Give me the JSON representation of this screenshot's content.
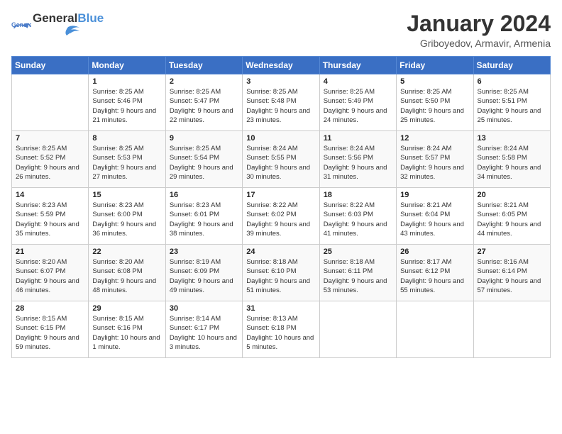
{
  "logo": {
    "text_general": "General",
    "text_blue": "Blue"
  },
  "title": "January 2024",
  "subtitle": "Griboyedov, Armavir, Armenia",
  "weekdays": [
    "Sunday",
    "Monday",
    "Tuesday",
    "Wednesday",
    "Thursday",
    "Friday",
    "Saturday"
  ],
  "weeks": [
    [
      {
        "day": "",
        "sunrise": "",
        "sunset": "",
        "daylight": ""
      },
      {
        "day": "1",
        "sunrise": "Sunrise: 8:25 AM",
        "sunset": "Sunset: 5:46 PM",
        "daylight": "Daylight: 9 hours and 21 minutes."
      },
      {
        "day": "2",
        "sunrise": "Sunrise: 8:25 AM",
        "sunset": "Sunset: 5:47 PM",
        "daylight": "Daylight: 9 hours and 22 minutes."
      },
      {
        "day": "3",
        "sunrise": "Sunrise: 8:25 AM",
        "sunset": "Sunset: 5:48 PM",
        "daylight": "Daylight: 9 hours and 23 minutes."
      },
      {
        "day": "4",
        "sunrise": "Sunrise: 8:25 AM",
        "sunset": "Sunset: 5:49 PM",
        "daylight": "Daylight: 9 hours and 24 minutes."
      },
      {
        "day": "5",
        "sunrise": "Sunrise: 8:25 AM",
        "sunset": "Sunset: 5:50 PM",
        "daylight": "Daylight: 9 hours and 25 minutes."
      },
      {
        "day": "6",
        "sunrise": "Sunrise: 8:25 AM",
        "sunset": "Sunset: 5:51 PM",
        "daylight": "Daylight: 9 hours and 25 minutes."
      }
    ],
    [
      {
        "day": "7",
        "sunrise": "Sunrise: 8:25 AM",
        "sunset": "Sunset: 5:52 PM",
        "daylight": "Daylight: 9 hours and 26 minutes."
      },
      {
        "day": "8",
        "sunrise": "Sunrise: 8:25 AM",
        "sunset": "Sunset: 5:53 PM",
        "daylight": "Daylight: 9 hours and 27 minutes."
      },
      {
        "day": "9",
        "sunrise": "Sunrise: 8:25 AM",
        "sunset": "Sunset: 5:54 PM",
        "daylight": "Daylight: 9 hours and 29 minutes."
      },
      {
        "day": "10",
        "sunrise": "Sunrise: 8:24 AM",
        "sunset": "Sunset: 5:55 PM",
        "daylight": "Daylight: 9 hours and 30 minutes."
      },
      {
        "day": "11",
        "sunrise": "Sunrise: 8:24 AM",
        "sunset": "Sunset: 5:56 PM",
        "daylight": "Daylight: 9 hours and 31 minutes."
      },
      {
        "day": "12",
        "sunrise": "Sunrise: 8:24 AM",
        "sunset": "Sunset: 5:57 PM",
        "daylight": "Daylight: 9 hours and 32 minutes."
      },
      {
        "day": "13",
        "sunrise": "Sunrise: 8:24 AM",
        "sunset": "Sunset: 5:58 PM",
        "daylight": "Daylight: 9 hours and 34 minutes."
      }
    ],
    [
      {
        "day": "14",
        "sunrise": "Sunrise: 8:23 AM",
        "sunset": "Sunset: 5:59 PM",
        "daylight": "Daylight: 9 hours and 35 minutes."
      },
      {
        "day": "15",
        "sunrise": "Sunrise: 8:23 AM",
        "sunset": "Sunset: 6:00 PM",
        "daylight": "Daylight: 9 hours and 36 minutes."
      },
      {
        "day": "16",
        "sunrise": "Sunrise: 8:23 AM",
        "sunset": "Sunset: 6:01 PM",
        "daylight": "Daylight: 9 hours and 38 minutes."
      },
      {
        "day": "17",
        "sunrise": "Sunrise: 8:22 AM",
        "sunset": "Sunset: 6:02 PM",
        "daylight": "Daylight: 9 hours and 39 minutes."
      },
      {
        "day": "18",
        "sunrise": "Sunrise: 8:22 AM",
        "sunset": "Sunset: 6:03 PM",
        "daylight": "Daylight: 9 hours and 41 minutes."
      },
      {
        "day": "19",
        "sunrise": "Sunrise: 8:21 AM",
        "sunset": "Sunset: 6:04 PM",
        "daylight": "Daylight: 9 hours and 43 minutes."
      },
      {
        "day": "20",
        "sunrise": "Sunrise: 8:21 AM",
        "sunset": "Sunset: 6:05 PM",
        "daylight": "Daylight: 9 hours and 44 minutes."
      }
    ],
    [
      {
        "day": "21",
        "sunrise": "Sunrise: 8:20 AM",
        "sunset": "Sunset: 6:07 PM",
        "daylight": "Daylight: 9 hours and 46 minutes."
      },
      {
        "day": "22",
        "sunrise": "Sunrise: 8:20 AM",
        "sunset": "Sunset: 6:08 PM",
        "daylight": "Daylight: 9 hours and 48 minutes."
      },
      {
        "day": "23",
        "sunrise": "Sunrise: 8:19 AM",
        "sunset": "Sunset: 6:09 PM",
        "daylight": "Daylight: 9 hours and 49 minutes."
      },
      {
        "day": "24",
        "sunrise": "Sunrise: 8:18 AM",
        "sunset": "Sunset: 6:10 PM",
        "daylight": "Daylight: 9 hours and 51 minutes."
      },
      {
        "day": "25",
        "sunrise": "Sunrise: 8:18 AM",
        "sunset": "Sunset: 6:11 PM",
        "daylight": "Daylight: 9 hours and 53 minutes."
      },
      {
        "day": "26",
        "sunrise": "Sunrise: 8:17 AM",
        "sunset": "Sunset: 6:12 PM",
        "daylight": "Daylight: 9 hours and 55 minutes."
      },
      {
        "day": "27",
        "sunrise": "Sunrise: 8:16 AM",
        "sunset": "Sunset: 6:14 PM",
        "daylight": "Daylight: 9 hours and 57 minutes."
      }
    ],
    [
      {
        "day": "28",
        "sunrise": "Sunrise: 8:15 AM",
        "sunset": "Sunset: 6:15 PM",
        "daylight": "Daylight: 9 hours and 59 minutes."
      },
      {
        "day": "29",
        "sunrise": "Sunrise: 8:15 AM",
        "sunset": "Sunset: 6:16 PM",
        "daylight": "Daylight: 10 hours and 1 minute."
      },
      {
        "day": "30",
        "sunrise": "Sunrise: 8:14 AM",
        "sunset": "Sunset: 6:17 PM",
        "daylight": "Daylight: 10 hours and 3 minutes."
      },
      {
        "day": "31",
        "sunrise": "Sunrise: 8:13 AM",
        "sunset": "Sunset: 6:18 PM",
        "daylight": "Daylight: 10 hours and 5 minutes."
      },
      {
        "day": "",
        "sunrise": "",
        "sunset": "",
        "daylight": ""
      },
      {
        "day": "",
        "sunrise": "",
        "sunset": "",
        "daylight": ""
      },
      {
        "day": "",
        "sunrise": "",
        "sunset": "",
        "daylight": ""
      }
    ]
  ]
}
